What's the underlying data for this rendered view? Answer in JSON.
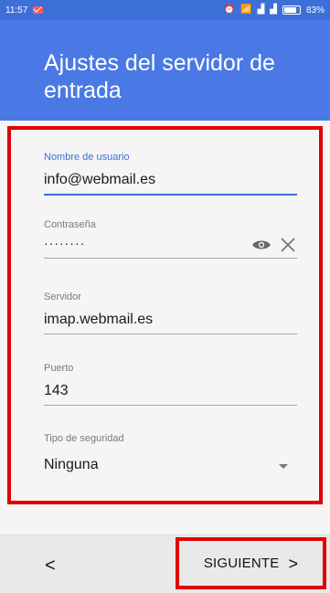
{
  "status_bar": {
    "time": "11:57",
    "battery_text": "83%",
    "battery_level": 0.83
  },
  "header": {
    "title": "Ajustes del servidor de entrada"
  },
  "form": {
    "username": {
      "label": "Nombre de usuario",
      "value": "info@webmail.es"
    },
    "password": {
      "label": "Contraseña",
      "value": "········"
    },
    "server": {
      "label": "Servidor",
      "value": "imap.webmail.es"
    },
    "port": {
      "label": "Puerto",
      "value": "143"
    },
    "security": {
      "label": "Tipo de seguridad",
      "value": "Ninguna"
    }
  },
  "footer": {
    "back_label": "<",
    "next_label": "SIGUIENTE",
    "next_chevron": ">"
  },
  "colors": {
    "header_bg": "#4a79e5",
    "accent": "#3d6fd8",
    "highlight_frame": "#e00000"
  }
}
